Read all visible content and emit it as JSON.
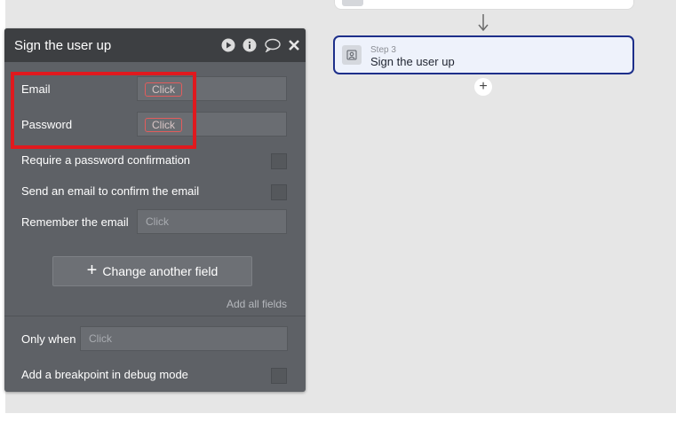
{
  "canvas": {
    "active_step": {
      "step_number": "Step 3",
      "title": "Sign the user up"
    },
    "add_step_label": "+"
  },
  "panel": {
    "title": "Sign the user up",
    "header_icons": [
      "play-icon",
      "info-icon",
      "comment-icon",
      "close-icon"
    ],
    "fields": [
      {
        "label": "Email",
        "placeholder": "Click"
      },
      {
        "label": "Password",
        "placeholder": "Click"
      }
    ],
    "checkbox_rows": [
      {
        "label": "Require a password confirmation",
        "checked": false
      },
      {
        "label": "Send an email to confirm the email",
        "checked": false
      }
    ],
    "remember": {
      "label": "Remember the email",
      "placeholder": "Click"
    },
    "change_button": {
      "icon": "+",
      "label": "Change another field"
    },
    "add_all_fields": "Add all fields",
    "only_when": {
      "label": "Only when",
      "placeholder": "Click"
    },
    "breakpoint": {
      "label": "Add a breakpoint in debug mode",
      "checked": false
    }
  },
  "colors": {
    "highlight": "#e0191e",
    "step_border": "#1d2f8a",
    "panel_bg": "#5e6166",
    "panel_header": "#3d3f42"
  }
}
